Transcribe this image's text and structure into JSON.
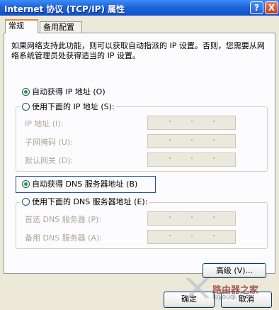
{
  "window": {
    "title": "Internet 协议 (TCP/IP) 属性",
    "help_btn": "?",
    "close_btn": "X"
  },
  "tabs": [
    {
      "label": "常规",
      "active": true
    },
    {
      "label": "备用配置",
      "active": false
    }
  ],
  "description": "如果网络支持此功能，则可以获取自动指派的 IP 设置。否则，您需要从网络系统管理员处获得适当的 IP 设置。",
  "ip": {
    "auto_label": "自动获得 IP 地址 (O)",
    "auto_checked": true,
    "manual_label": "使用下面的 IP 地址 (S):",
    "manual_checked": false,
    "fields": [
      {
        "label": "IP 地址 (I):",
        "value": ""
      },
      {
        "label": "子网掩码 (U):",
        "value": ""
      },
      {
        "label": "默认网关 (D):",
        "value": ""
      }
    ]
  },
  "dns": {
    "auto_label": "自动获得 DNS 服务器地址 (B)",
    "auto_checked": true,
    "manual_label": "使用下面的 DNS 服务器地址 (E):",
    "manual_checked": false,
    "fields": [
      {
        "label": "首选 DNS 服务器 (P):",
        "value": ""
      },
      {
        "label": "备用 DNS 服务器 (A):",
        "value": ""
      }
    ]
  },
  "buttons": {
    "advanced": "高级 (V)...",
    "ok": "确定",
    "cancel": "取消"
  },
  "watermark": {
    "text": "路由器之家",
    "url": "luyouqi.com"
  },
  "colors": {
    "titlebar": "#0E4FC9",
    "dialog_bg": "#ECE9D8",
    "radio_dot": "#21A121",
    "tab_highlight": "#E68B2C"
  }
}
